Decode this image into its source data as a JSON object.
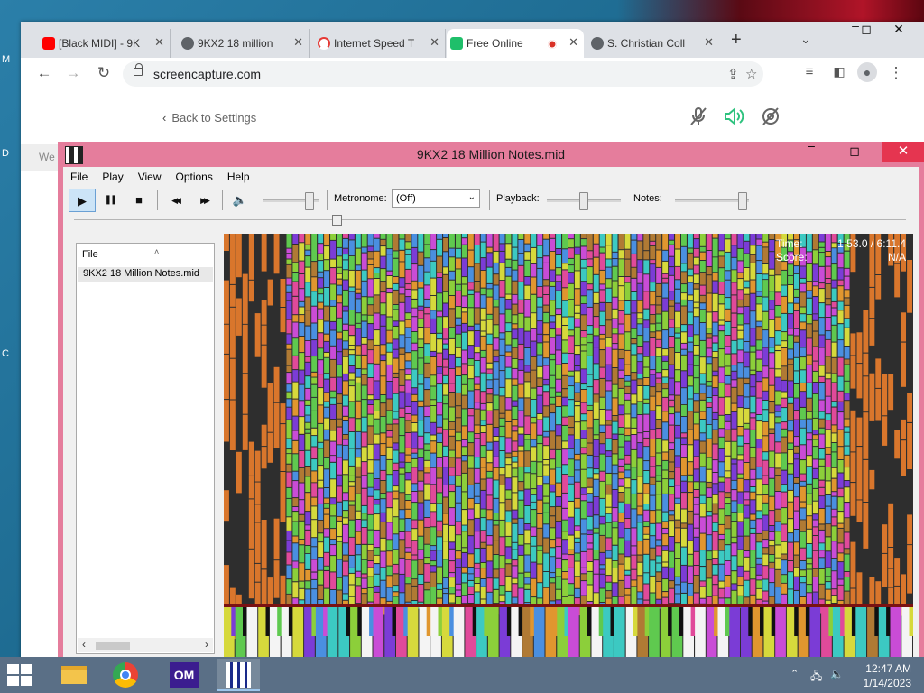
{
  "desktop": {
    "edge_letters": [
      "M",
      "D",
      "C"
    ]
  },
  "browser": {
    "tabs": [
      {
        "title": "[Black MIDI] - 9K",
        "favicon_color": "#ff0000",
        "icon": "youtube-icon"
      },
      {
        "title": "9KX2 18 million",
        "favicon_color": "#5f6368",
        "icon": "globe-icon"
      },
      {
        "title": "Internet Speed T",
        "favicon_color": "#e53935",
        "icon": "speedometer-icon"
      },
      {
        "title": "Free Online",
        "favicon_color": "#1fbf6a",
        "icon": "screencapture-icon",
        "active": true
      },
      {
        "title": "S. Christian Coll",
        "favicon_color": "#5f6368",
        "icon": "globe-icon"
      }
    ],
    "close_glyph": "✕",
    "new_tab_glyph": "+",
    "tab_search_glyph": "⌄",
    "address": {
      "url": "screencapture.com"
    },
    "window_controls": {
      "minimize": "‒",
      "maximize": "◻",
      "close": "✕"
    }
  },
  "page": {
    "back_link": "Back to Settings",
    "back_glyph": "‹",
    "sidebar_peek": "We",
    "icons": {
      "mic_muted": "🎤",
      "speaker_on": "🔊",
      "camera_off": "⊘"
    }
  },
  "app": {
    "title": "9KX2 18 Million Notes.mid",
    "menu": [
      "File",
      "Play",
      "View",
      "Options",
      "Help"
    ],
    "controls": {
      "play": "▶",
      "pause": "❚❚",
      "stop": "■",
      "rewind": "◀◀",
      "forward": "▶▶",
      "volume": "🔈"
    },
    "metronome": {
      "label": "Metronome:",
      "value": "(Off)"
    },
    "playback_label": "Playback:",
    "notes_label": "Notes:",
    "levels": {
      "volume": 0.85,
      "playback": 0.48,
      "notes": 0.95,
      "seek": 0.31
    },
    "file_panel": {
      "header": "File",
      "items": [
        "9KX2 18 Million Notes.mid"
      ]
    },
    "hud": {
      "time_label": "Time:",
      "time_value": "1:53.0 / 6:11.4",
      "score_label": "Score:",
      "score_value": "N/A"
    }
  },
  "taskbar": {
    "apps": [
      {
        "name": "file-explorer",
        "icon": "folder-icon",
        "color": "#f3c44b"
      },
      {
        "name": "chrome",
        "icon": "chrome-icon",
        "color": "#34a853"
      },
      {
        "name": "om",
        "icon": "om-icon",
        "label": "OM",
        "color": "#3b1d8f"
      },
      {
        "name": "piano-from-above",
        "icon": "piano-icon",
        "color": "#1a2a8a",
        "active": true
      }
    ],
    "clock": {
      "time": "12:47 AM",
      "date": "1/14/2023"
    }
  }
}
